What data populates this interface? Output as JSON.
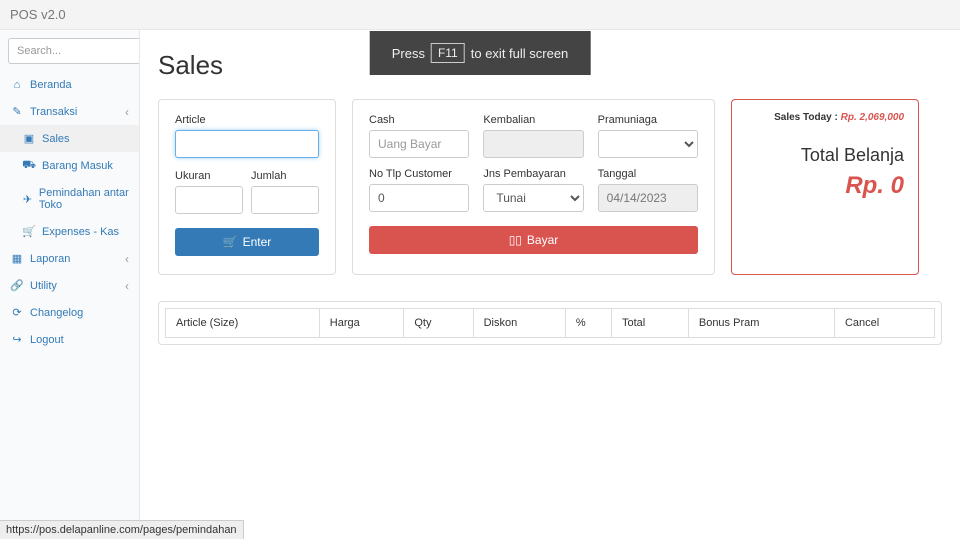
{
  "app_title": "POS v2.0",
  "search": {
    "placeholder": "Search..."
  },
  "nav": {
    "beranda": "Beranda",
    "transaksi": "Transaksi",
    "sales": "Sales",
    "barang_masuk": "Barang Masuk",
    "pemindahan": "Pemindahan antar Toko",
    "expenses": "Expenses - Kas",
    "laporan": "Laporan",
    "utility": "Utility",
    "changelog": "Changelog",
    "logout": "Logout"
  },
  "fullscreen": {
    "press": "Press",
    "key": "F11",
    "rest": "to exit full screen"
  },
  "page_heading": "Sales",
  "left_panel": {
    "article_label": "Article",
    "ukuran_label": "Ukuran",
    "jumlah_label": "Jumlah",
    "enter_btn": "Enter"
  },
  "mid_panel": {
    "cash_label": "Cash",
    "cash_placeholder": "Uang Bayar",
    "kembalian_label": "Kembalian",
    "pramuniaga_label": "Pramuniaga",
    "notlp_label": "No Tlp Customer",
    "notlp_value": "0",
    "jns_label": "Jns Pembayaran",
    "jns_value": "Tunai",
    "tanggal_label": "Tanggal",
    "tanggal_value": "04/14/2023",
    "bayar_btn": "Bayar"
  },
  "right_panel": {
    "sales_today_label": "Sales Today :",
    "sales_today_value": "Rp. 2,069,000",
    "total_label": "Total Belanja",
    "total_value": "Rp. 0"
  },
  "table": {
    "cols": {
      "article": "Article (Size)",
      "harga": "Harga",
      "qty": "Qty",
      "diskon": "Diskon",
      "pct": "%",
      "total": "Total",
      "bonus": "Bonus Pram",
      "cancel": "Cancel"
    }
  },
  "status_url": "https://pos.delapanline.com/pages/pemindahan"
}
